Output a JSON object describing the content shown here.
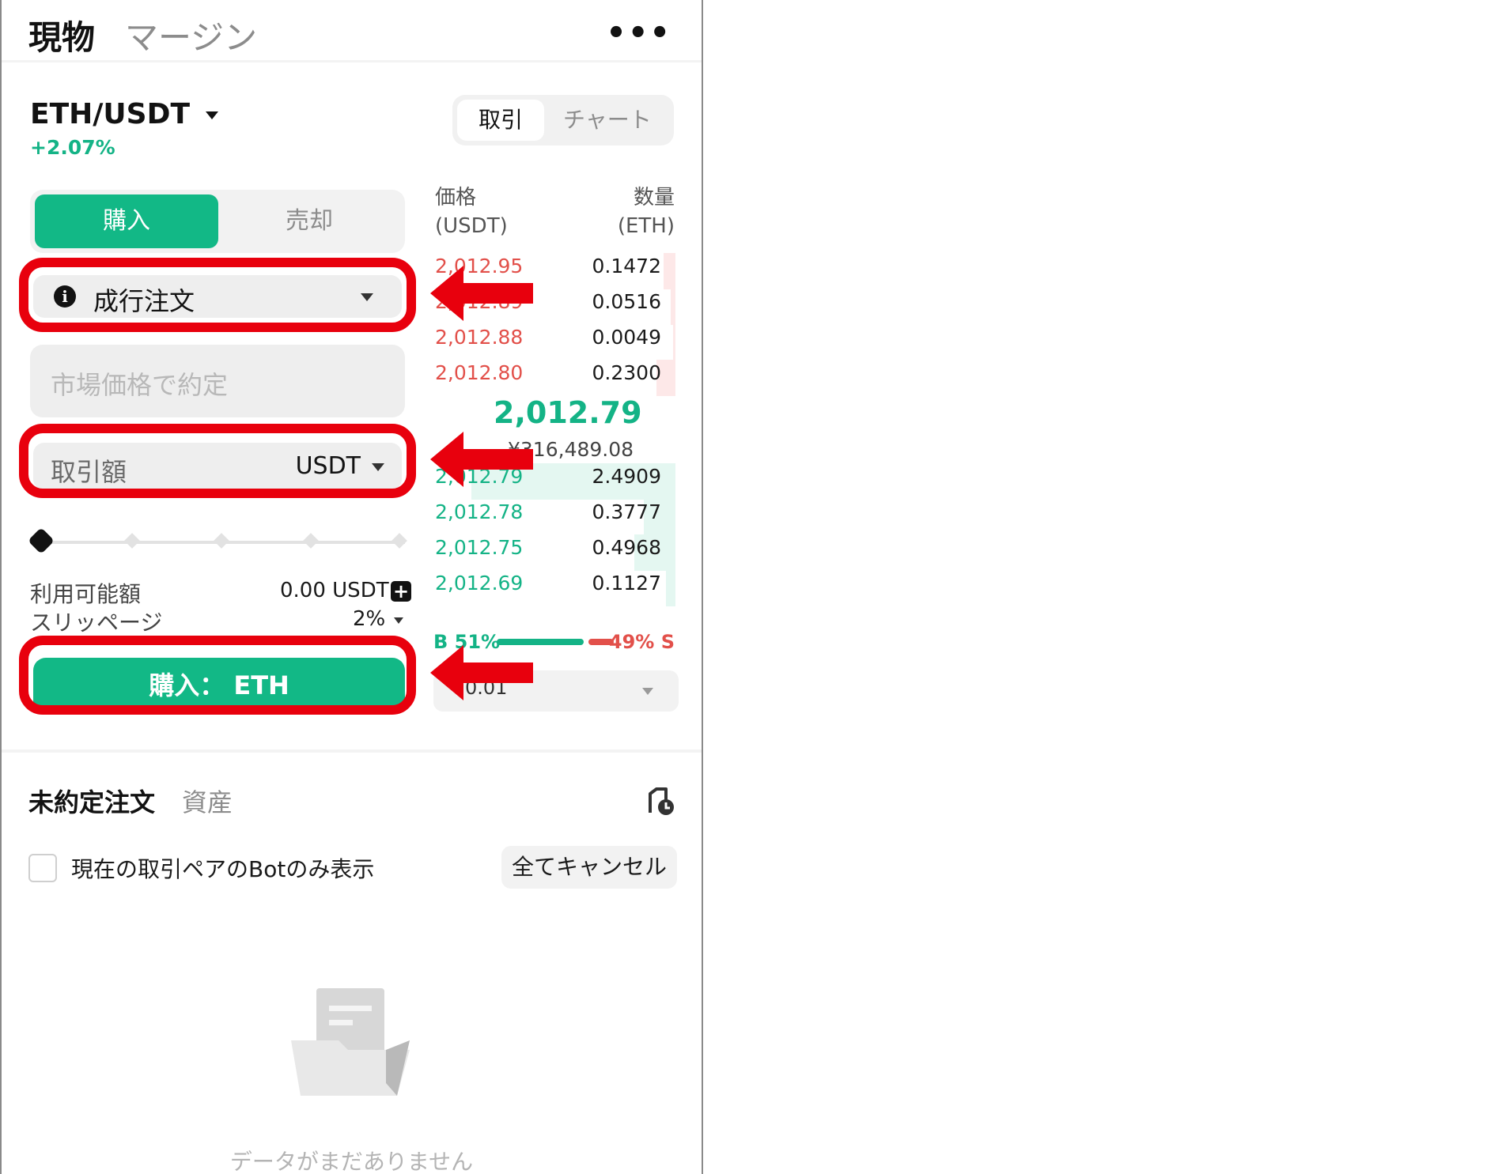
{
  "top_tabs": {
    "spot": "現物",
    "margin": "マージン"
  },
  "more_icon": "more-horizontal-icon",
  "pair": {
    "name": "ETH/USDT",
    "change": "+2.07%"
  },
  "view_toggle": {
    "trade": "取引",
    "chart": "チャート"
  },
  "side_toggle": {
    "buy": "購入",
    "sell": "売却"
  },
  "order_type": {
    "label": "成行注文",
    "icon": "info-icon"
  },
  "price_field": {
    "placeholder": "市場価格で約定"
  },
  "amount_field": {
    "label": "取引額",
    "unit": "USDT"
  },
  "slider": {
    "percent": 0,
    "steps": 5
  },
  "available": {
    "label": "利用可能額",
    "value": "0.00 USDT"
  },
  "slippage": {
    "label": "スリッページ",
    "value": "2%"
  },
  "buy_button": {
    "label": "購入： ETH"
  },
  "order_book": {
    "price_header": "価格",
    "price_unit": "(USDT)",
    "qty_header": "数量",
    "qty_unit": "(ETH)",
    "asks": [
      {
        "price": "2,012.95",
        "qty": "0.1472",
        "depth": 0.05
      },
      {
        "price": "2,012.89",
        "qty": "0.0516",
        "depth": 0.02
      },
      {
        "price": "2,012.88",
        "qty": "0.0049",
        "depth": 0.01
      },
      {
        "price": "2,012.80",
        "qty": "0.2300",
        "depth": 0.08
      }
    ],
    "last_price": "2,012.79",
    "fiat_price": "¥316,489.08",
    "bids": [
      {
        "price": "2,012.79",
        "qty": "2.4909",
        "depth": 0.85
      },
      {
        "price": "2,012.78",
        "qty": "0.3777",
        "depth": 0.13
      },
      {
        "price": "2,012.75",
        "qty": "0.4968",
        "depth": 0.17
      },
      {
        "price": "2,012.69",
        "qty": "0.1127",
        "depth": 0.04
      }
    ],
    "ratio": {
      "buy": "B 51%",
      "sell": "49% S",
      "buy_share": 0.51
    },
    "depth_select": "0.01"
  },
  "bottom_tabs": {
    "open_orders": "未約定注文",
    "assets": "資産"
  },
  "history_icon": "history-icon",
  "bot_filter": {
    "label": "現在の取引ペアのBotのみ表示",
    "checked": false
  },
  "cancel_all": "全てキャンセル",
  "empty_state": {
    "text": "データがまだありません",
    "icon": "empty-folder-icon"
  },
  "colors": {
    "accent": "#12b886",
    "bid": "#14b386",
    "ask": "#e2504a",
    "highlight": "#e8000d"
  }
}
